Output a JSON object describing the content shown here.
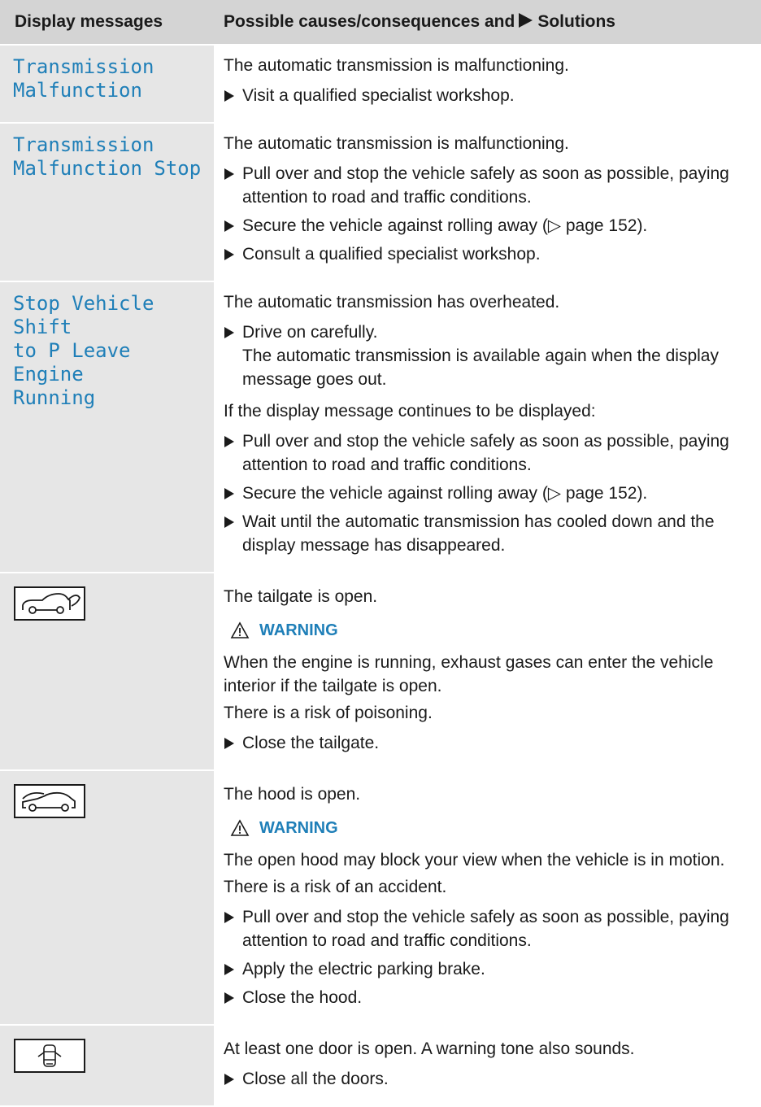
{
  "header": {
    "col1": "Display messages",
    "col2_prefix": "Possible causes/consequences and",
    "col2_suffix": "Solutions"
  },
  "rows": [
    {
      "message": "Transmission\nMalfunction",
      "cause": "The automatic transmission is malfunctioning.",
      "steps": [
        "Visit a qualified specialist workshop."
      ]
    },
    {
      "message": "Transmission\nMalfunction Stop",
      "cause": "The automatic transmission is malfunctioning.",
      "steps": [
        "Pull over and stop the vehicle safely as soon as possible, paying attention to road and traffic conditions.",
        "Secure the vehicle against rolling away (▷ page 152).",
        "Consult a qualified specialist workshop."
      ]
    },
    {
      "message": "Stop Vehicle Shift\nto P Leave Engine\nRunning",
      "cause": "The automatic transmission has overheated.",
      "step1": "Drive on carefully.",
      "step1_note": "The automatic transmission is available again when the display message goes out.",
      "condition": "If the display message continues to be displayed:",
      "steps": [
        "Pull over and stop the vehicle safely as soon as possible, paying attention to road and traffic conditions.",
        "Secure the vehicle against rolling away (▷ page 152).",
        "Wait until the automatic transmission has cooled down and the display message has disappeared."
      ]
    },
    {
      "icon": "tailgate-open-icon",
      "cause": "The tailgate is open.",
      "warning_label": "WARNING",
      "warning_text": "When the engine is running, exhaust gases can enter the vehicle interior if the tailgate is open.",
      "risk": "There is a risk of poisoning.",
      "steps": [
        "Close the tailgate."
      ]
    },
    {
      "icon": "hood-open-icon",
      "cause": "The hood is open.",
      "warning_label": "WARNING",
      "warning_text": "The open hood may block your view when the vehicle is in motion.",
      "risk": "There is a risk of an accident.",
      "steps": [
        "Pull over and stop the vehicle safely as soon as possible, paying attention to road and traffic conditions.",
        "Apply the electric parking brake.",
        "Close the hood."
      ]
    },
    {
      "icon": "door-open-icon",
      "cause": "At least one door is open. A warning tone also sounds.",
      "steps": [
        "Close all the doors."
      ]
    }
  ],
  "colors": {
    "accent_blue": "#1f7fb8",
    "header_gray": "#d4d4d4",
    "cell_gray": "#e6e6e6"
  }
}
